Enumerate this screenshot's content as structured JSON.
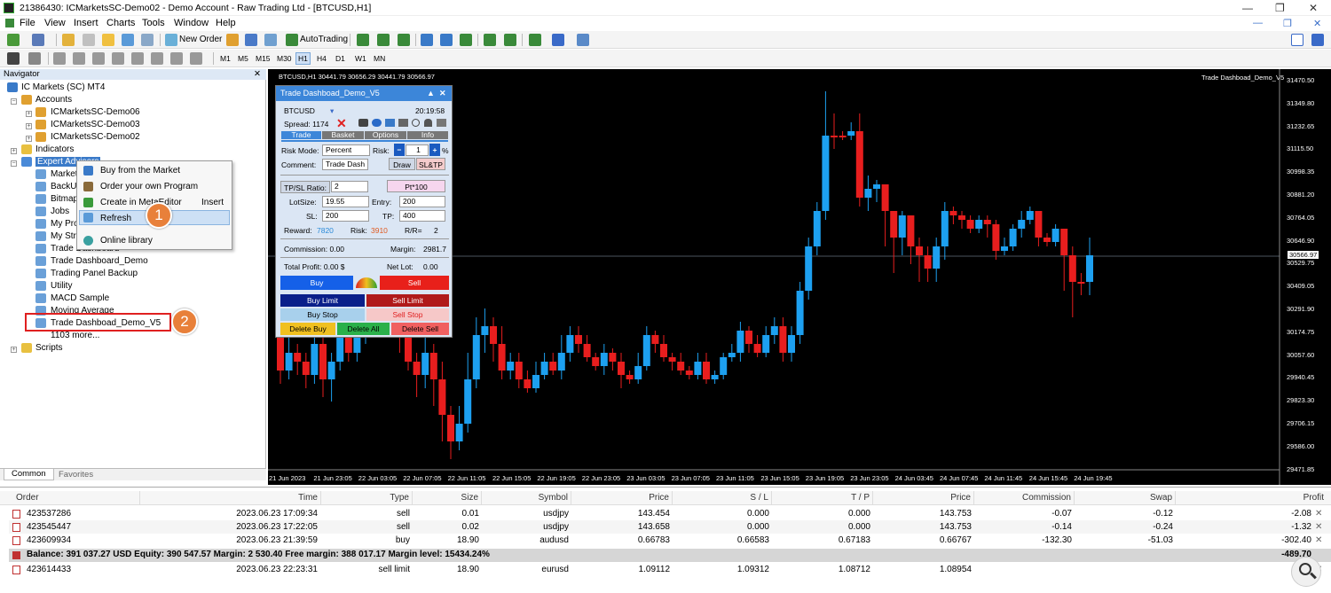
{
  "window": {
    "title": "21386430: ICMarketsSC-Demo02 - Demo Account - Raw Trading Ltd - [BTCUSD,H1]",
    "min": "—",
    "max": "❐",
    "close": "✕"
  },
  "menu": [
    "File",
    "View",
    "Insert",
    "Charts",
    "Tools",
    "Window",
    "Help"
  ],
  "toolbar": {
    "new_order": "New Order",
    "autotrading": "AutoTrading",
    "timeframes": [
      "M1",
      "M5",
      "M15",
      "M30",
      "H1",
      "H4",
      "D1",
      "W1",
      "MN"
    ]
  },
  "navigator": {
    "title": "Navigator",
    "close": "✕",
    "root": "IC Markets (SC) MT4",
    "accounts_label": "Accounts",
    "accounts": [
      "ICMarketsSC-Demo06",
      "ICMarketsSC-Demo03",
      "ICMarketsSC-Demo02"
    ],
    "indicators": "Indicators",
    "expert_advisors": "Expert Advisors",
    "experts": [
      "Market",
      "BackUp",
      "Bitmap",
      "Jobs",
      "My Pro",
      "My Stra",
      "Trade Dashboard",
      "Trade Dashboard_Demo",
      "Trading Panel Backup",
      "Utility",
      "MACD Sample",
      "Moving Average",
      "Trade Dashboad_Demo_V5",
      "1103 more..."
    ],
    "scripts": "Scripts",
    "tabs": [
      "Common",
      "Favorites"
    ]
  },
  "context_menu": {
    "items": [
      "Buy from the Market",
      "Order your own Program",
      "Create in MetaEditor",
      "Refresh",
      "Online library"
    ],
    "shortcut": "Insert"
  },
  "badges": [
    "1",
    "2"
  ],
  "chart": {
    "title": "BTCUSD,H1  30441.79 30656.29 30441.79 30566.97",
    "ea_label": "Trade Dashboad_Demo_V5",
    "current_price": "30566.97",
    "price_labels": [
      "31470.50",
      "31349.80",
      "31232.65",
      "31115.50",
      "30998.35",
      "30881.20",
      "30764.05",
      "30646.90",
      "30529.75",
      "30409.05",
      "30291.90",
      "30174.75",
      "30057.60",
      "29940.45",
      "29823.30",
      "29706.15",
      "29586.00",
      "29471.85"
    ],
    "time_labels": [
      "21 Jun 2023",
      "21 Jun 23:05",
      "22 Jun 03:05",
      "22 Jun 07:05",
      "22 Jun 11:05",
      "22 Jun 15:05",
      "22 Jun 19:05",
      "22 Jun 23:05",
      "23 Jun 03:05",
      "23 Jun 07:05",
      "23 Jun 11:05",
      "23 Jun 15:05",
      "23 Jun 19:05",
      "23 Jun 23:05",
      "24 Jun 03:45",
      "24 Jun 07:45",
      "24 Jun 11:45",
      "24 Jun 15:45",
      "24 Jun 19:45"
    ]
  },
  "dashboard": {
    "title": "Trade Dashboad_Demo_V5",
    "symbol": "BTCUSD",
    "time": "20:19:58",
    "spread": "Spread: 1174",
    "tabs": [
      "Trade",
      "Basket",
      "Options",
      "Info"
    ],
    "risk_mode_label": "Risk Mode:",
    "risk_mode": "Percent",
    "risk_label": "Risk:",
    "risk_value": "1",
    "pct": "%",
    "minus": "−",
    "plus": "+",
    "comment_label": "Comment:",
    "comment_value": "Trade Dash",
    "draw": "Draw",
    "sltp": "SL&TP",
    "tpsl_label": "TP/SL Ratio:",
    "tpsl_value": "2",
    "pt": "Pt*100",
    "lot_label": "LotSize:",
    "lot_value": "19.55",
    "entry_label": "Entry:",
    "entry_value": "200",
    "sl_label": "SL:",
    "sl_value": "200",
    "tp_label": "TP:",
    "tp_value": "400",
    "reward_label": "Reward:",
    "reward_value": "7820",
    "risk2_label": "Risk:",
    "risk2_value": "3910",
    "rr_label": "R/R=",
    "rr_value": "2",
    "commission": "Commission: 0.00",
    "margin_label": "Margin:",
    "margin_value": "2981.7",
    "total_profit": "Total Profit: 0.00 $",
    "net_lot_label": "Net Lot:",
    "net_lot_value": "0.00",
    "buy": "Buy",
    "sell": "Sell",
    "buy_limit": "Buy Limit",
    "sell_limit": "Sell Limit",
    "buy_stop": "Buy Stop",
    "sell_stop": "Sell Stop",
    "delete_buy": "Delete Buy",
    "delete_all": "Delete All",
    "delete_sell": "Delete Sell"
  },
  "terminal": {
    "headers": [
      "Order",
      "Time",
      "Type",
      "Size",
      "Symbol",
      "Price",
      "S / L",
      "T / P",
      "Price",
      "Commission",
      "Swap",
      "Profit"
    ],
    "rows": [
      {
        "order": "423537286",
        "time": "2023.06.23 17:09:34",
        "type": "sell",
        "size": "0.01",
        "symbol": "usdjpy",
        "price": "143.454",
        "sl": "0.000",
        "tp": "0.000",
        "cur": "143.753",
        "commission": "-0.07",
        "swap": "-0.12",
        "profit": "-2.08"
      },
      {
        "order": "423545447",
        "time": "2023.06.23 17:22:05",
        "type": "sell",
        "size": "0.02",
        "symbol": "usdjpy",
        "price": "143.658",
        "sl": "0.000",
        "tp": "0.000",
        "cur": "143.753",
        "commission": "-0.14",
        "swap": "-0.24",
        "profit": "-1.32"
      },
      {
        "order": "423609934",
        "time": "2023.06.23 21:39:59",
        "type": "buy",
        "size": "18.90",
        "symbol": "audusd",
        "price": "0.66783",
        "sl": "0.66583",
        "tp": "0.67183",
        "cur": "0.66767",
        "commission": "-132.30",
        "swap": "-51.03",
        "profit": "-302.40"
      }
    ],
    "balance": "Balance: 391 037.27 USD  Equity: 390 547.57  Margin: 2 530.40  Free margin: 388 017.17  Margin level: 15434.24%",
    "balance_profit": "-489.70",
    "pending": {
      "order": "423614433",
      "time": "2023.06.23 22:23:31",
      "type": "sell limit",
      "size": "18.90",
      "symbol": "eurusd",
      "price": "1.09112",
      "sl": "1.09312",
      "tp": "1.08712",
      "cur": "1.08954"
    }
  }
}
